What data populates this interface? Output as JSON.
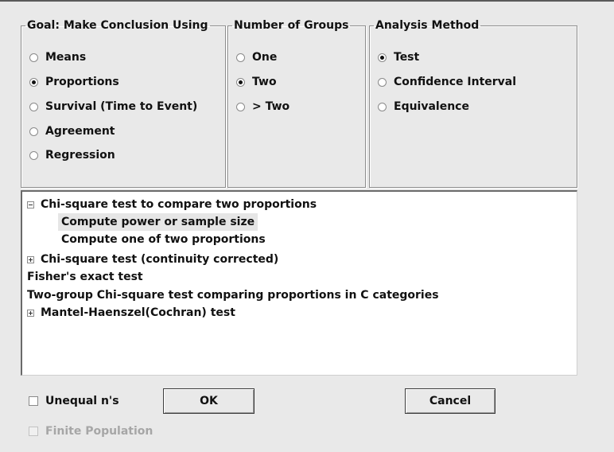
{
  "goal": {
    "legend": "Goal: Make Conclusion Using",
    "options": [
      {
        "label": "Means",
        "selected": false
      },
      {
        "label": "Proportions",
        "selected": true
      },
      {
        "label": "Survival (Time to Event)",
        "selected": false
      },
      {
        "label": "Agreement",
        "selected": false
      },
      {
        "label": "Regression",
        "selected": false
      }
    ]
  },
  "groups": {
    "legend": "Number of Groups",
    "options": [
      {
        "label": "One",
        "selected": false
      },
      {
        "label": "Two",
        "selected": true
      },
      {
        "label": "> Two",
        "selected": false
      }
    ]
  },
  "method": {
    "legend": "Analysis Method",
    "options": [
      {
        "label": "Test",
        "selected": true
      },
      {
        "label": "Confidence Interval",
        "selected": false
      },
      {
        "label": "Equivalence",
        "selected": false
      }
    ]
  },
  "tree": {
    "items": [
      {
        "label": "Chi-square test to compare two proportions",
        "toggle": "minus",
        "expanded": true
      },
      {
        "label": "Compute power or sample size",
        "selected": true
      },
      {
        "label": "Compute one of two proportions"
      },
      {
        "label": "Chi-square test (continuity corrected)",
        "toggle": "plus"
      },
      {
        "label": "Fisher's exact test"
      },
      {
        "label": "Two-group Chi-square test comparing proportions in C categories"
      },
      {
        "label": "Mantel-Haenszel(Cochran) test",
        "toggle": "plus"
      }
    ]
  },
  "options": {
    "unequal_n": {
      "label": "Unequal n's",
      "checked": false,
      "enabled": true
    },
    "finite_population": {
      "label": "Finite Population",
      "checked": false,
      "enabled": false
    }
  },
  "buttons": {
    "ok": "OK",
    "cancel": "Cancel"
  }
}
